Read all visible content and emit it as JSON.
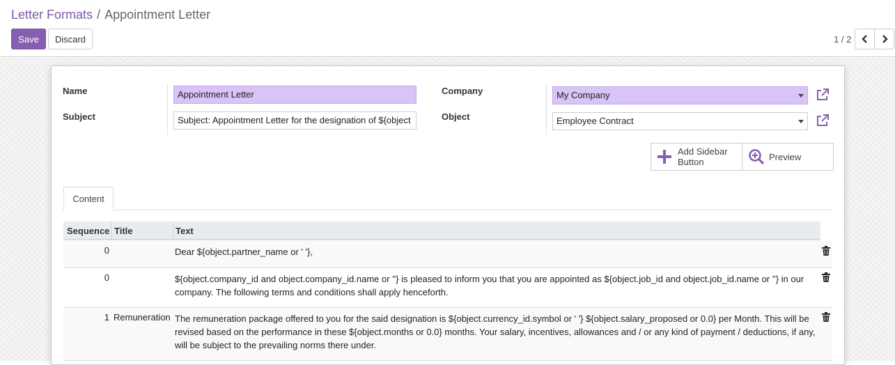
{
  "breadcrumb": {
    "parent": "Letter Formats",
    "separator": "/",
    "current": "Appointment Letter"
  },
  "toolbar": {
    "save_label": "Save",
    "discard_label": "Discard"
  },
  "pager": {
    "value": "1 / 2"
  },
  "form": {
    "name_label": "Name",
    "name_value": "Appointment Letter",
    "subject_label": "Subject",
    "subject_value": "Subject:  Appointment Letter for the designation of ${object",
    "company_label": "Company",
    "company_value": "My Company",
    "object_label": "Object",
    "object_value": "Employee Contract"
  },
  "actions": {
    "add_sidebar_line1": "Add Sidebar",
    "add_sidebar_line2": "Button",
    "preview": "Preview"
  },
  "tabs": [
    {
      "label": "Content"
    }
  ],
  "table": {
    "headers": {
      "sequence": "Sequence",
      "title": "Title",
      "text": "Text"
    },
    "rows": [
      {
        "sequence": "0",
        "title": "",
        "text": "Dear ${object.partner_name or ' '},"
      },
      {
        "sequence": "0",
        "title": "",
        "text": "${object.company_id and object.company_id.name or ''} is pleased to inform you that you are appointed as ${object.job_id and object.job_id.name or ''} in our company. The following terms and conditions shall apply henceforth."
      },
      {
        "sequence": "1",
        "title": "Remuneration",
        "text": "The remuneration package offered to you for the said designation is ${object.currency_id.symbol or ' '} ${object.salary_proposed or 0.0} per Month. This will be revised based on the performance in these ${object.months or 0.0} months. Your salary, incentives, allowances and / or any kind of payment / deductions, if any, will be subject to the prevailing norms there under."
      }
    ]
  },
  "colors": {
    "accent": "#875fb0",
    "required_field": "#d8c4f7",
    "link": "#7c5ba6"
  },
  "icons": [
    "chevron-left-icon",
    "chevron-right-icon",
    "external-link-icon",
    "plus-icon",
    "zoom-in-icon",
    "trash-icon",
    "caret-down-icon"
  ]
}
